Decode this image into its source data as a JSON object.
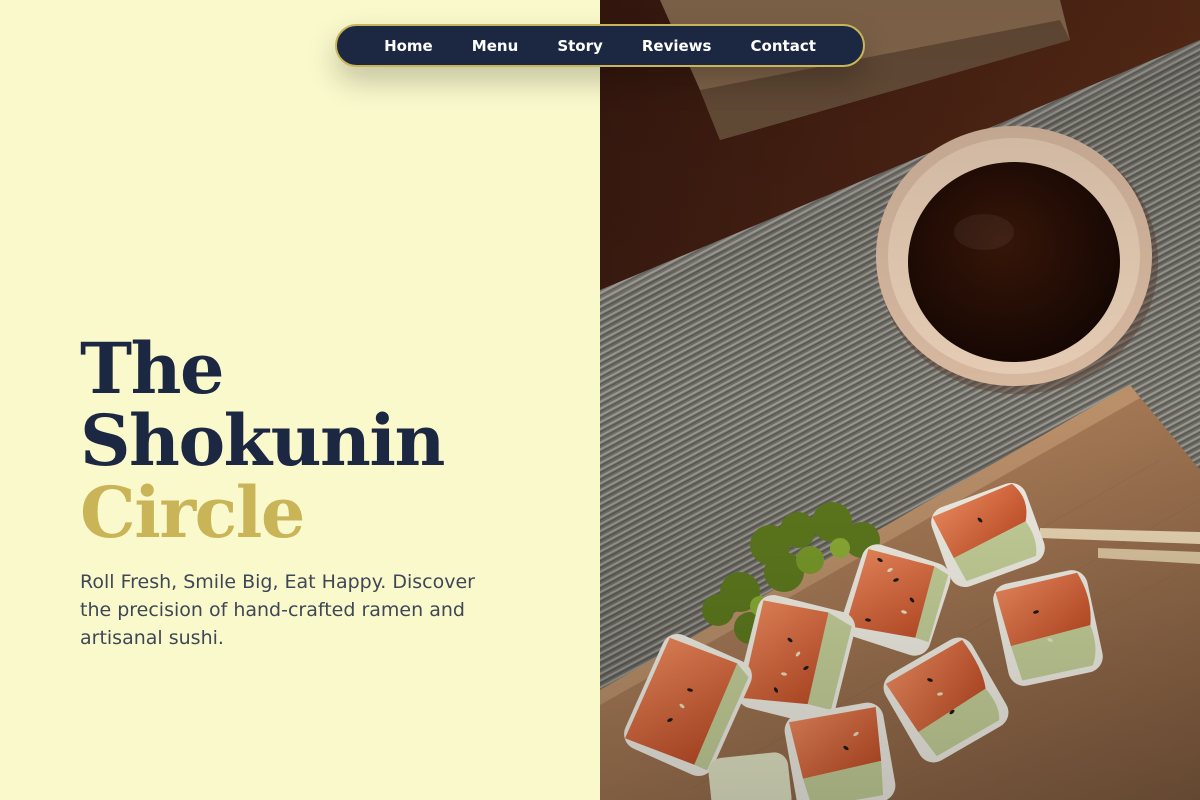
{
  "nav": {
    "items": [
      {
        "label": "Home"
      },
      {
        "label": "Menu"
      },
      {
        "label": "Story"
      },
      {
        "label": "Reviews"
      },
      {
        "label": "Contact"
      }
    ]
  },
  "hero": {
    "title_line1": "The",
    "title_line2": "Shokunin",
    "title_line3": "Circle",
    "tagline": "Roll Fresh, Smile Big, Eat Happy. Discover the precision of hand-crafted ramen and artisanal sushi."
  },
  "photo": {
    "subject": "sushi-rolls-with-soy-sauce-photo"
  },
  "colors": {
    "background": "#FAF9CC",
    "navy": "#1C2842",
    "gold": "#C9B458",
    "body_text": "#3F4756"
  }
}
